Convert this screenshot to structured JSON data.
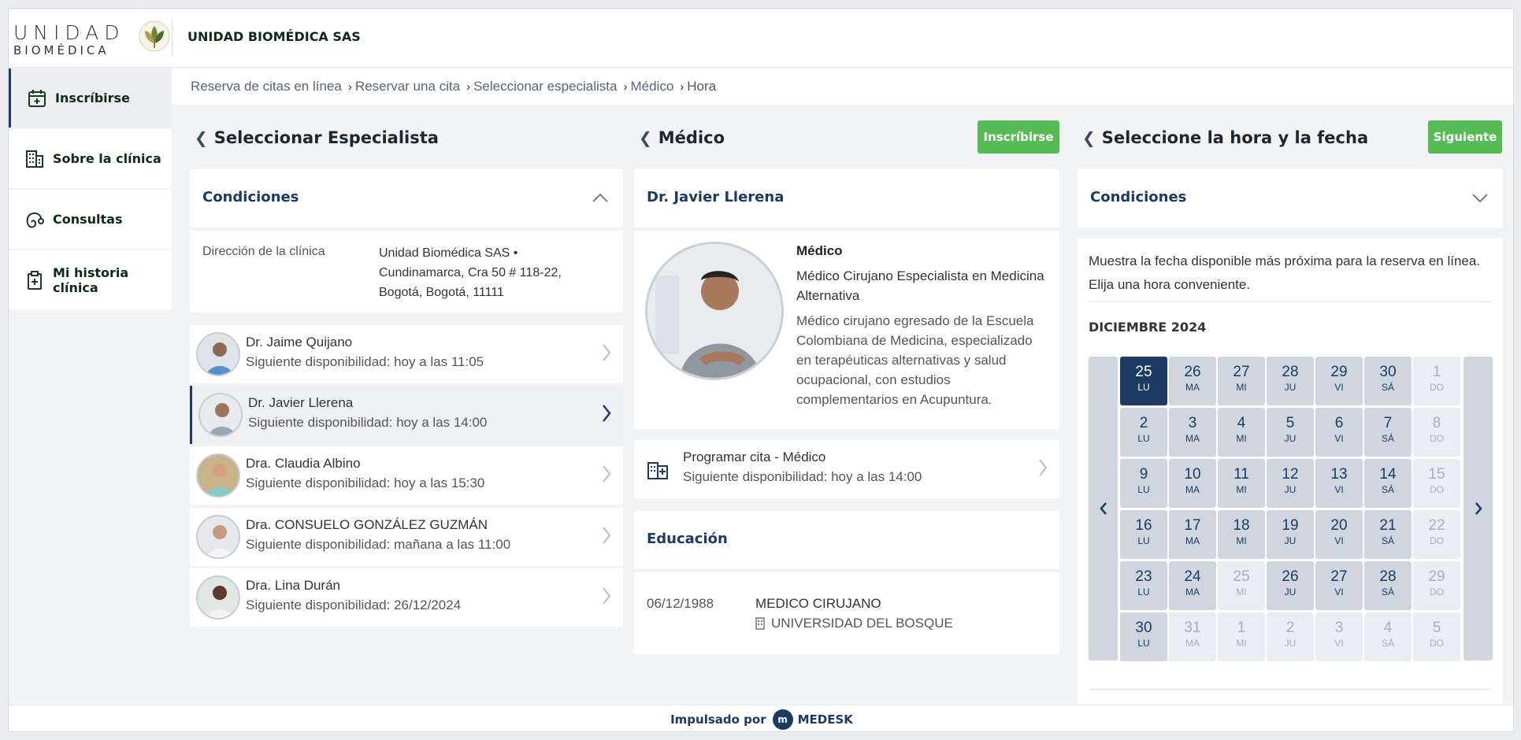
{
  "header": {
    "logo_line1": "UNIDAD",
    "logo_line2": "BIOMÉDICA",
    "org_name": "UNIDAD BIOMÉDICA SAS"
  },
  "sidebar": {
    "items": [
      {
        "label": "Inscríbirse",
        "icon": "calendar-plus-icon",
        "active": true
      },
      {
        "label": "Sobre la clínica",
        "icon": "building-icon",
        "active": false
      },
      {
        "label": "Consultas",
        "icon": "stethoscope-icon",
        "active": false
      },
      {
        "label": "Mi historia clínica",
        "icon": "clipboard-icon",
        "active": false
      }
    ]
  },
  "breadcrumb": [
    "Reserva de citas en línea",
    "Reservar una cita",
    "Seleccionar especialista",
    "Médico",
    "Hora"
  ],
  "left": {
    "title": "Seleccionar Especialista",
    "conditions_title": "Condiciones",
    "address_label": "Dirección de la clínica",
    "address_value": "Unidad Biomédica SAS • Cundinamarca, Cra 50 # 118-22, Bogotá, Bogotá, 11111",
    "doctors": [
      {
        "name": "Dr. Jaime Quijano",
        "availability": "Siguiente disponibilidad: hoy a las 11:05",
        "selected": false
      },
      {
        "name": "Dr. Javier Llerena",
        "availability": "Siguiente disponibilidad: hoy a las 14:00",
        "selected": true
      },
      {
        "name": "Dra. Claudia Albino",
        "availability": "Siguiente disponibilidad: hoy a las 15:30",
        "selected": false
      },
      {
        "name": "Dra. CONSUELO GONZÁLEZ GUZMÁN",
        "availability": "Siguiente disponibilidad: mañana a las 11:00",
        "selected": false
      },
      {
        "name": "Dra. Lina Durán",
        "availability": "Siguiente disponibilidad: 26/12/2024",
        "selected": false
      }
    ]
  },
  "middle": {
    "title": "Médico",
    "enroll_button": "Inscríbirse",
    "doctor_name": "Dr. Javier Llerena",
    "role": "Médico",
    "specialty": "Médico Cirujano Especialista en Medicina Alternativa",
    "bio": "Médico cirujano egresado de la Escuela Colombiana de Medicina, especializado en terapéuticas alternativas y salud ocupacional, con estudios complementarios en Acupuntura.",
    "schedule_title": "Programar cita - Médico",
    "schedule_availability": "Siguiente disponibilidad: hoy a las 14:00",
    "education_title": "Educación",
    "education": {
      "date": "06/12/1988",
      "degree": "MEDICO CIRUJANO",
      "university": "UNIVERSIDAD DEL BOSQUE"
    }
  },
  "right": {
    "title": "Seleccione la hora y la fecha",
    "next_button": "Siguiente",
    "conditions_title": "Condiciones",
    "intro": "Muestra la fecha disponible más próxima para la reserva en línea. Elija una hora conveniente.",
    "month": "DICIEMBRE 2024",
    "calendar": [
      [
        {
          "d": "25",
          "w": "LU",
          "s": "selected"
        },
        {
          "d": "26",
          "w": "MA",
          "s": "avail"
        },
        {
          "d": "27",
          "w": "MI",
          "s": "avail"
        },
        {
          "d": "28",
          "w": "JU",
          "s": "avail"
        },
        {
          "d": "29",
          "w": "VI",
          "s": "avail"
        },
        {
          "d": "30",
          "w": "SÁ",
          "s": "avail"
        },
        {
          "d": "1",
          "w": "DO",
          "s": "unavail"
        }
      ],
      [
        {
          "d": "2",
          "w": "LU",
          "s": "avail"
        },
        {
          "d": "3",
          "w": "MA",
          "s": "avail"
        },
        {
          "d": "4",
          "w": "MI",
          "s": "avail"
        },
        {
          "d": "5",
          "w": "JU",
          "s": "avail"
        },
        {
          "d": "6",
          "w": "VI",
          "s": "avail"
        },
        {
          "d": "7",
          "w": "SÁ",
          "s": "avail"
        },
        {
          "d": "8",
          "w": "DO",
          "s": "unavail"
        }
      ],
      [
        {
          "d": "9",
          "w": "LU",
          "s": "avail"
        },
        {
          "d": "10",
          "w": "MA",
          "s": "avail"
        },
        {
          "d": "11",
          "w": "MI",
          "s": "avail"
        },
        {
          "d": "12",
          "w": "JU",
          "s": "avail"
        },
        {
          "d": "13",
          "w": "VI",
          "s": "avail"
        },
        {
          "d": "14",
          "w": "SÁ",
          "s": "avail"
        },
        {
          "d": "15",
          "w": "DO",
          "s": "unavail"
        }
      ],
      [
        {
          "d": "16",
          "w": "LU",
          "s": "avail"
        },
        {
          "d": "17",
          "w": "MA",
          "s": "avail"
        },
        {
          "d": "18",
          "w": "MI",
          "s": "avail"
        },
        {
          "d": "19",
          "w": "JU",
          "s": "avail"
        },
        {
          "d": "20",
          "w": "VI",
          "s": "avail"
        },
        {
          "d": "21",
          "w": "SÁ",
          "s": "avail"
        },
        {
          "d": "22",
          "w": "DO",
          "s": "unavail"
        }
      ],
      [
        {
          "d": "23",
          "w": "LU",
          "s": "avail"
        },
        {
          "d": "24",
          "w": "MA",
          "s": "avail"
        },
        {
          "d": "25",
          "w": "MI",
          "s": "unavail"
        },
        {
          "d": "26",
          "w": "JU",
          "s": "avail"
        },
        {
          "d": "27",
          "w": "VI",
          "s": "avail"
        },
        {
          "d": "28",
          "w": "SÁ",
          "s": "avail"
        },
        {
          "d": "29",
          "w": "DO",
          "s": "unavail"
        }
      ],
      [
        {
          "d": "30",
          "w": "LU",
          "s": "avail"
        },
        {
          "d": "31",
          "w": "MA",
          "s": "unavail"
        },
        {
          "d": "1",
          "w": "MI",
          "s": "unavail"
        },
        {
          "d": "2",
          "w": "JU",
          "s": "unavail"
        },
        {
          "d": "3",
          "w": "VI",
          "s": "unavail"
        },
        {
          "d": "4",
          "w": "SÁ",
          "s": "unavail"
        },
        {
          "d": "5",
          "w": "DO",
          "s": "unavail"
        }
      ]
    ]
  },
  "footer": {
    "powered": "Impulsado por",
    "brand": "MEDESK"
  },
  "colors": {
    "primary": "#1c3a63",
    "accent_green": "#55bb55",
    "selected_day": "#1c3a63"
  }
}
